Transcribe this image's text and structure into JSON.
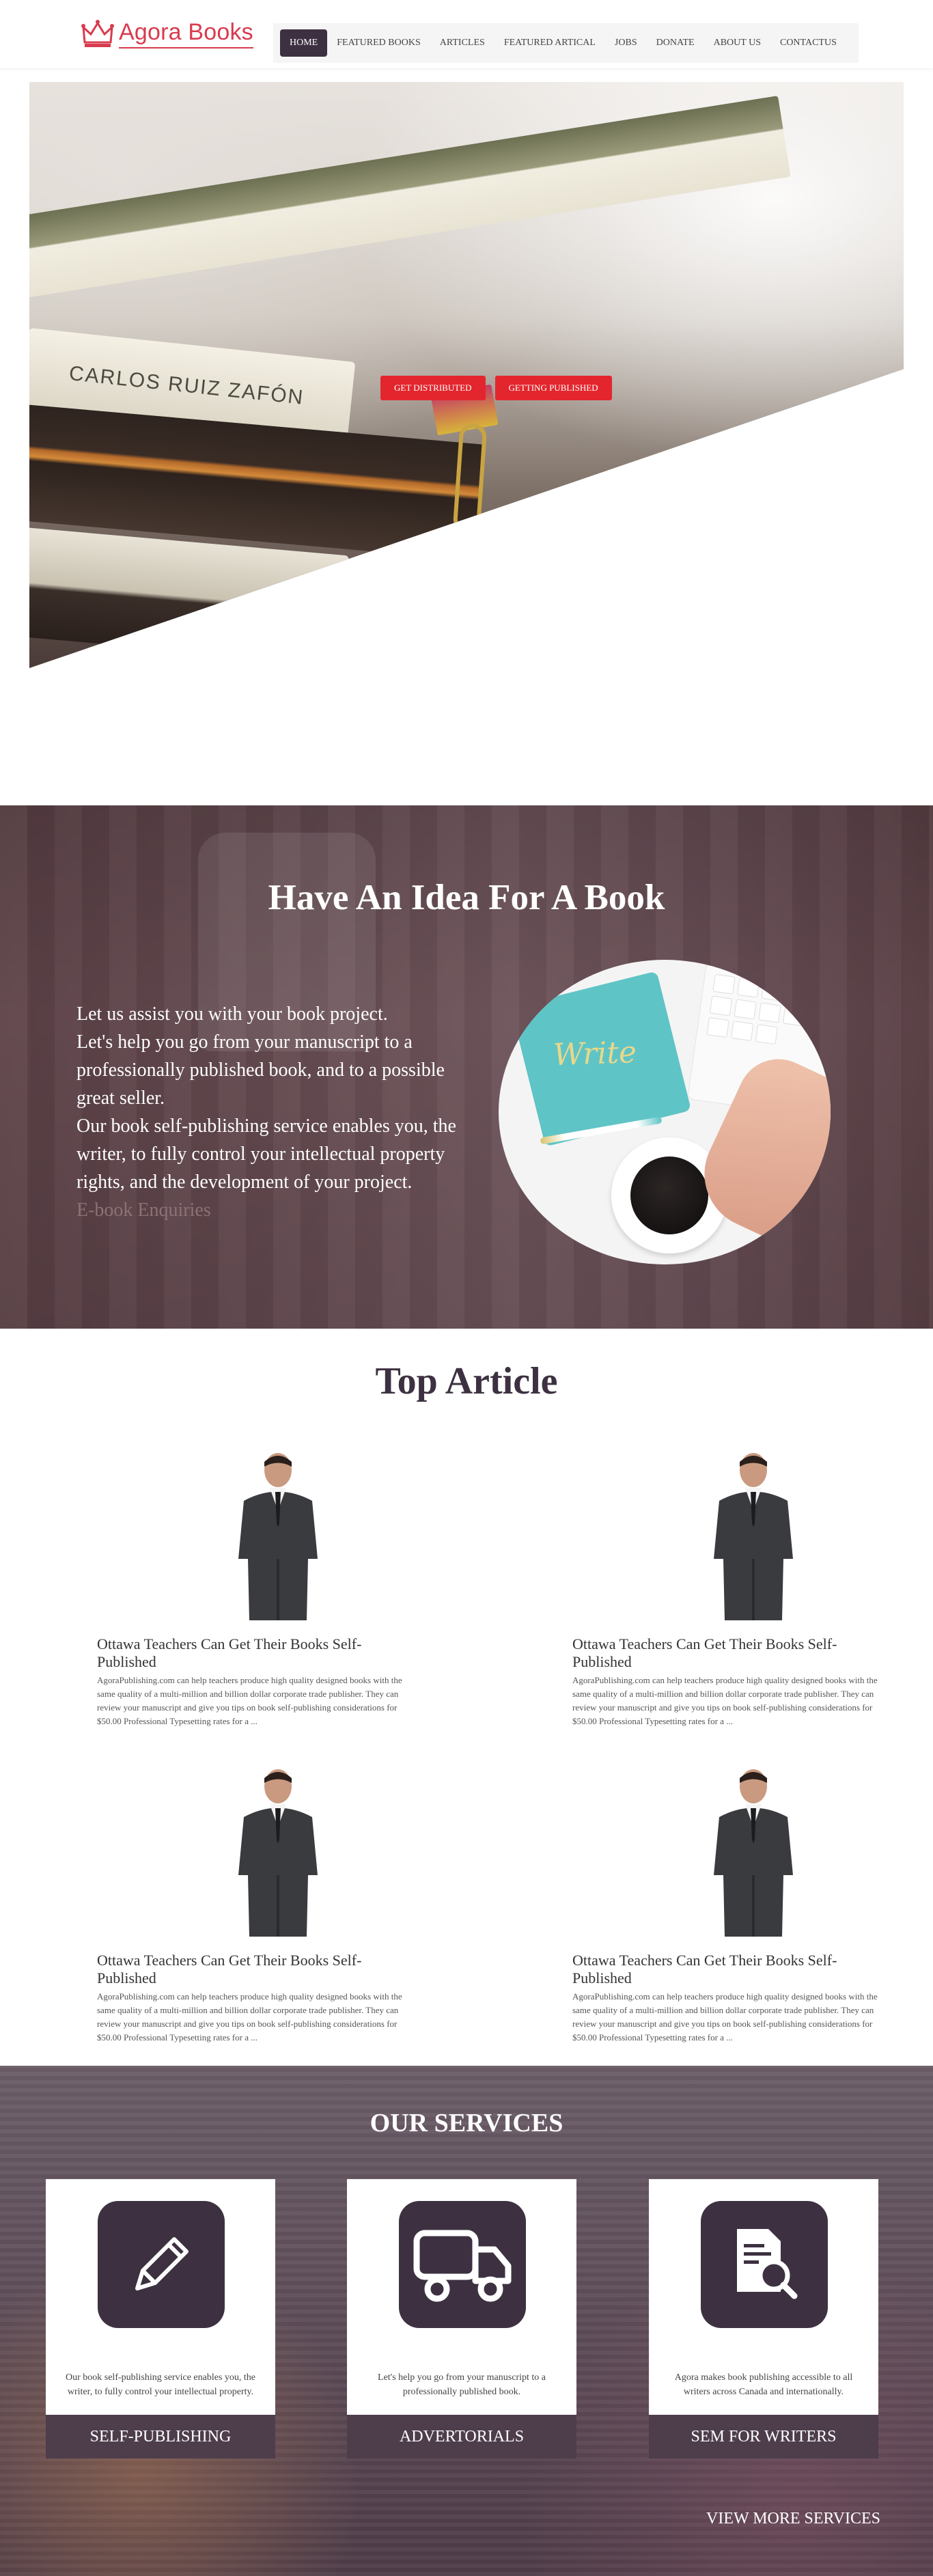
{
  "header": {
    "logo_text": "Agora Books",
    "nav": [
      {
        "label": "HOME",
        "active": true
      },
      {
        "label": "FEATURED BOOKS",
        "active": false
      },
      {
        "label": "ARTICLES",
        "active": false
      },
      {
        "label": "FEATURED ARTICAL",
        "active": false
      },
      {
        "label": "JOBS",
        "active": false
      },
      {
        "label": "DONATE",
        "active": false
      },
      {
        "label": "ABOUT US",
        "active": false
      },
      {
        "label": "CONTACTUS",
        "active": false
      }
    ]
  },
  "hero": {
    "book_title": "CARLOS RUIZ ZAFÓN",
    "buttons": [
      "GET DISTRIBUTED",
      "GETTING PUBLISHED"
    ]
  },
  "idea": {
    "title": "Have An Idea For A Book",
    "paragraphs": [
      "Let us assist you with your book project.",
      "Let's help you go from your manuscript to a professionally published book, and to a possible great seller.",
      "Our book self-publishing service enables you, the writer, to fully control your intellectual property rights, and the development of your project."
    ],
    "link": "E-book Enquiries",
    "image_word": "Write"
  },
  "articles": {
    "title": "Top Article",
    "items": [
      {
        "title": "Ottawa Teachers Can Get Their Books Self-Published",
        "text": "AgoraPublishing.com can help teachers produce high quality designed books with the same quality of a multi-million and billion dollar corporate trade publisher. They can review your manuscript and give you tips on book self-publishing considerations for $50.00 Professional Typesetting rates for a ..."
      },
      {
        "title": "Ottawa Teachers Can Get Their Books Self-Published",
        "text": "AgoraPublishing.com can help teachers produce high quality designed books with the same quality of a multi-million and billion dollar corporate trade publisher. They can review your manuscript and give you tips on book self-publishing considerations for $50.00 Professional Typesetting rates for a ..."
      },
      {
        "title": "Ottawa Teachers Can Get Their Books Self-Published",
        "text": "AgoraPublishing.com can help teachers produce high quality designed books with the same quality of a multi-million and billion dollar corporate trade publisher. They can review your manuscript and give you tips on book self-publishing considerations for $50.00 Professional Typesetting rates for a ..."
      },
      {
        "title": "Ottawa Teachers Can Get Their Books Self-Published",
        "text": "AgoraPublishing.com can help teachers produce high quality designed books with the same quality of a multi-million and billion dollar corporate trade publisher. They can review your manuscript and give you tips on book self-publishing considerations for $50.00 Professional Typesetting rates for a ..."
      }
    ]
  },
  "services": {
    "title": "OUR SERVICES",
    "cards": [
      {
        "icon": "pencil-icon",
        "desc": "Our book self-publishing service enables you, the writer, to fully control your intellectual property.",
        "label": "SELF-PUBLISHING"
      },
      {
        "icon": "truck-icon",
        "desc": "Let's help you go from your manuscript to a professionally published book.",
        "label": "ADVERTORIALS"
      },
      {
        "icon": "document-search-icon",
        "desc": "Agora makes book publishing accessible to all writers across Canada and internationally.",
        "label": "SEM FOR WRITERS"
      }
    ],
    "view_more": "VIEW MORE SERVICES"
  },
  "colors": {
    "brand": "#d93b4e",
    "nav_active": "#3d3141",
    "hero_button": "#e3262d",
    "service_label": "#4e3e4c"
  }
}
